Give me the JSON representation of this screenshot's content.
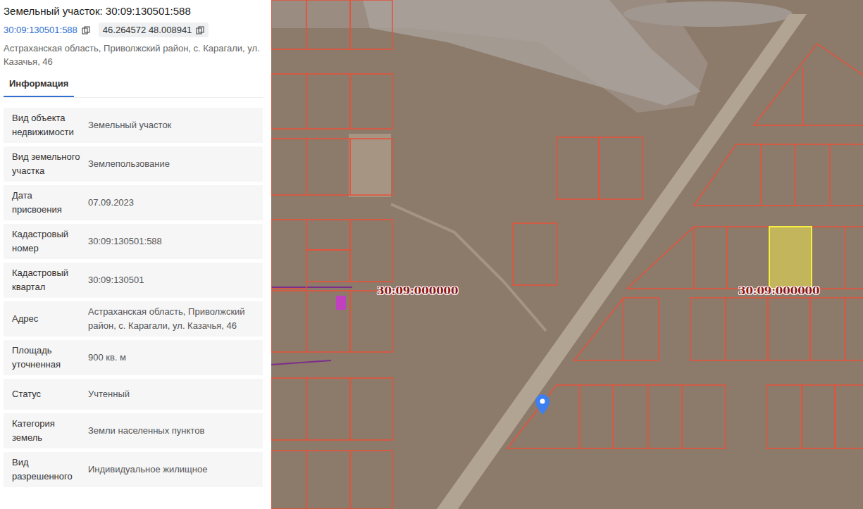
{
  "panel": {
    "title": "Земельный участок: 30:09:130501:588",
    "cadastral_link": "30:09:130501:588",
    "coordinates": "46.264572 48.008941",
    "address": "Астраханская область, Приволжский район, с. Карагали, ул. Казачья, 46",
    "tabs": [
      {
        "label": "Информация",
        "selected": true
      }
    ],
    "rows": [
      {
        "label": "Вид объекта недвижимости",
        "value": "Земельный участок"
      },
      {
        "label": "Вид земельного участка",
        "value": "Землепользование"
      },
      {
        "label": "Дата присвоения",
        "value": "07.09.2023"
      },
      {
        "label": "Кадастровый номер",
        "value": "30:09:130501:588"
      },
      {
        "label": "Кадастровый квартал",
        "value": "30:09:130501"
      },
      {
        "label": "Адрес",
        "value": "Астраханская область, Приволжский район, с. Карагали, ул. Казачья, 46"
      },
      {
        "label": "Площадь уточненная",
        "value": "900 кв. м"
      },
      {
        "label": "Статус",
        "value": "Учтенный"
      },
      {
        "label": "Категория земель",
        "value": "Земли населенных пунктов"
      },
      {
        "label": "Вид разрешенного",
        "value": "Индивидуальное жилищное"
      }
    ]
  },
  "map": {
    "labels": [
      {
        "text": "30:09:000000"
      },
      {
        "text": "30:09:000000"
      }
    ],
    "selected_parcel": {
      "selected": true
    }
  }
}
